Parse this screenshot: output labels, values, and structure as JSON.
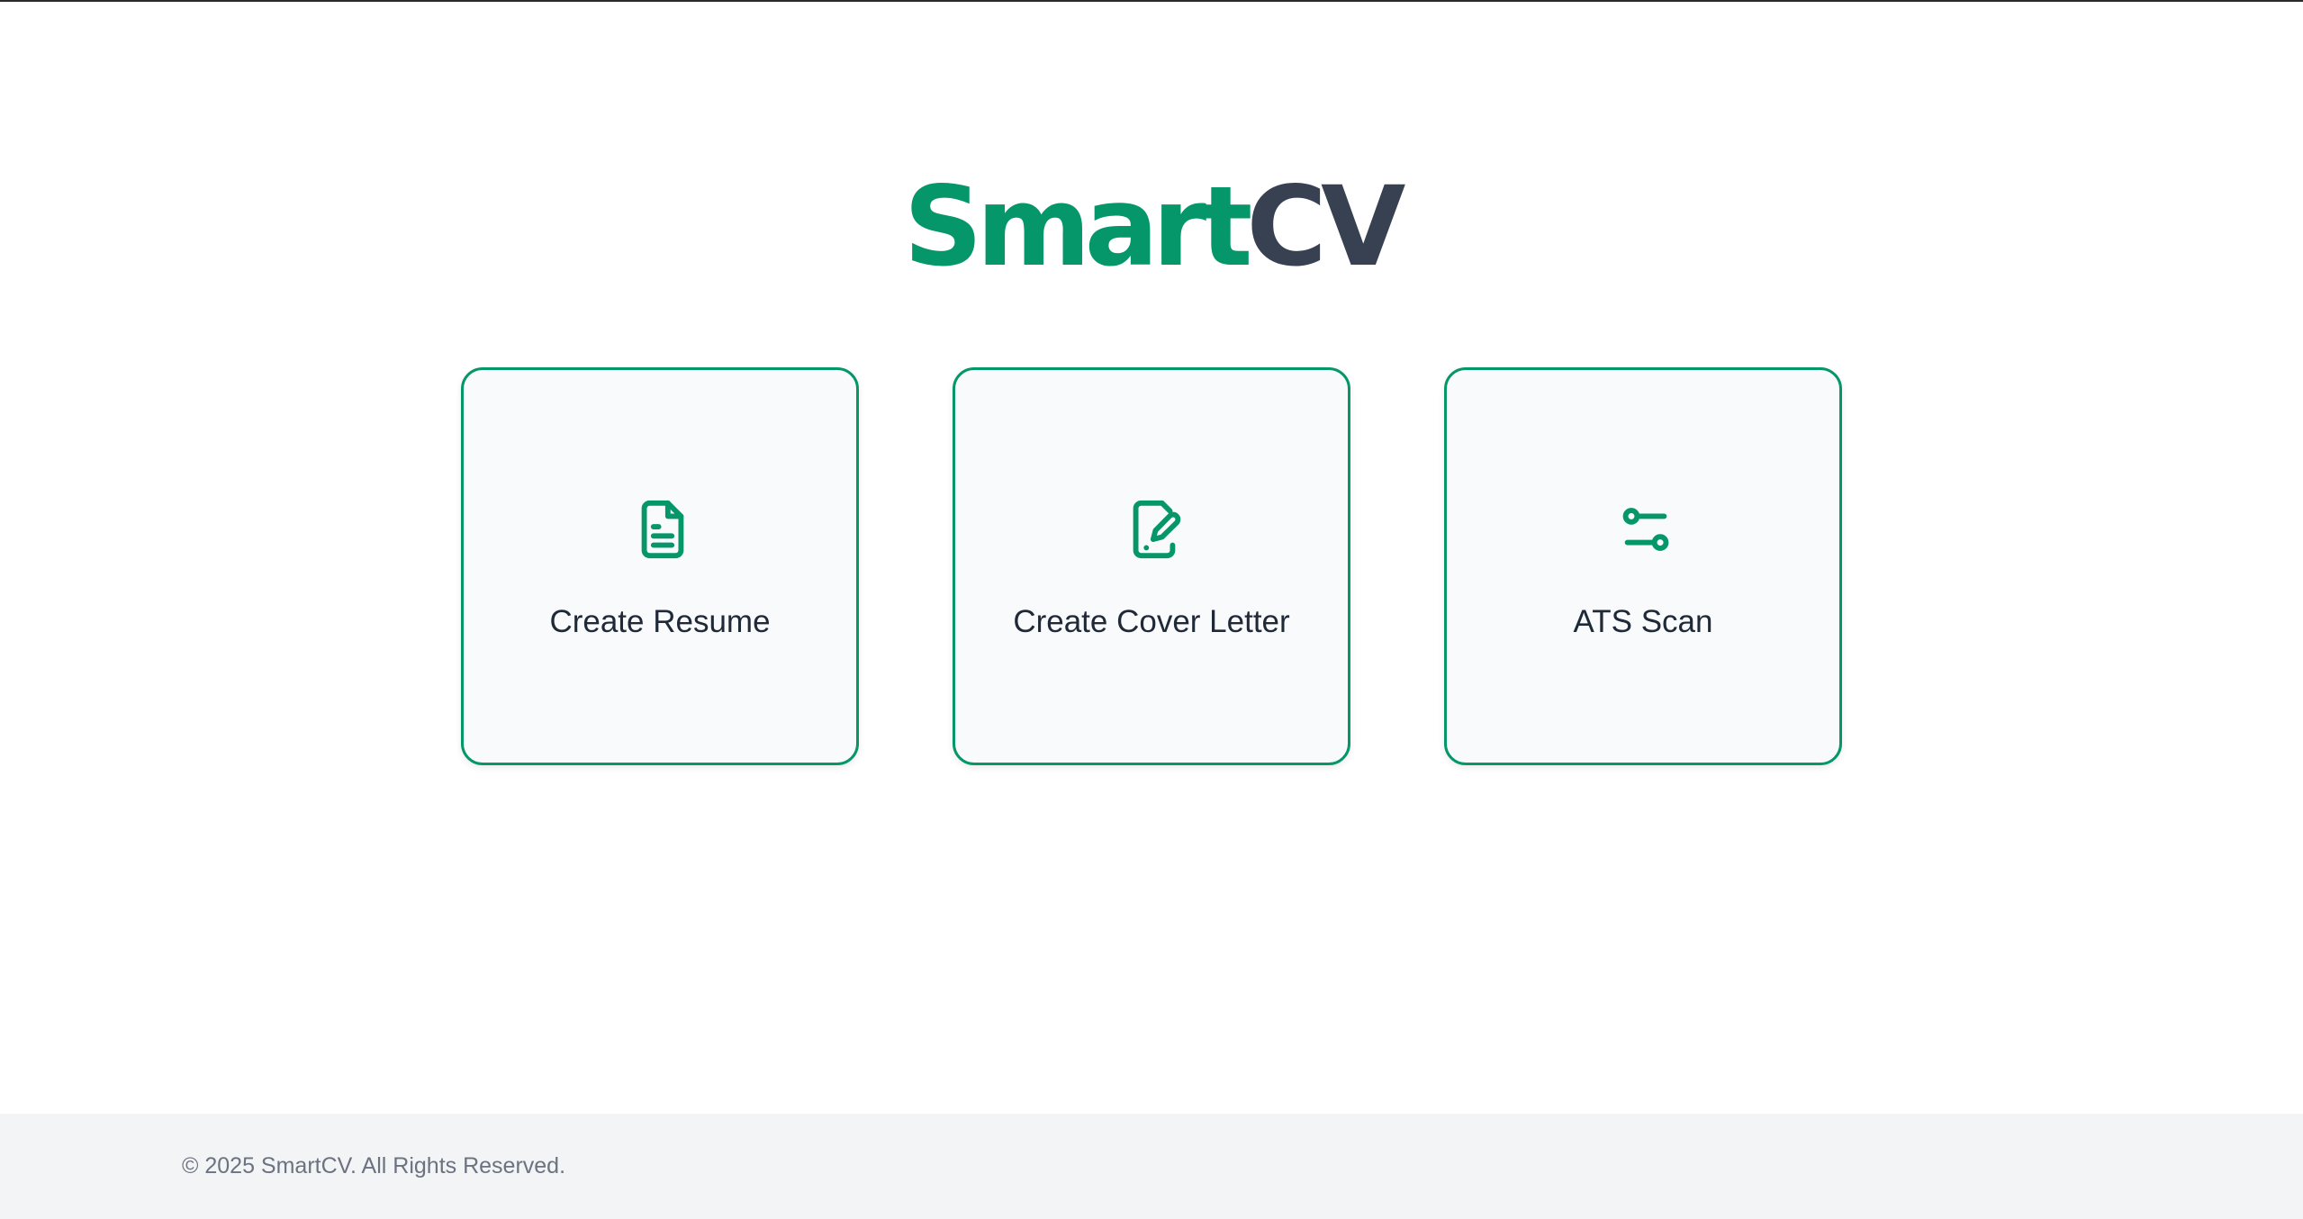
{
  "brand": {
    "name_part_1": "Smart",
    "name_part_2": "CV",
    "colors": {
      "accent": "#059669",
      "dark": "#374151"
    }
  },
  "cards": [
    {
      "label": "Create Resume",
      "icon": "document-icon"
    },
    {
      "label": "Create Cover Letter",
      "icon": "document-edit-icon"
    },
    {
      "label": "ATS Scan",
      "icon": "sliders-icon"
    }
  ],
  "footer": {
    "copyright": "© 2025 SmartCV. All Rights Reserved."
  }
}
